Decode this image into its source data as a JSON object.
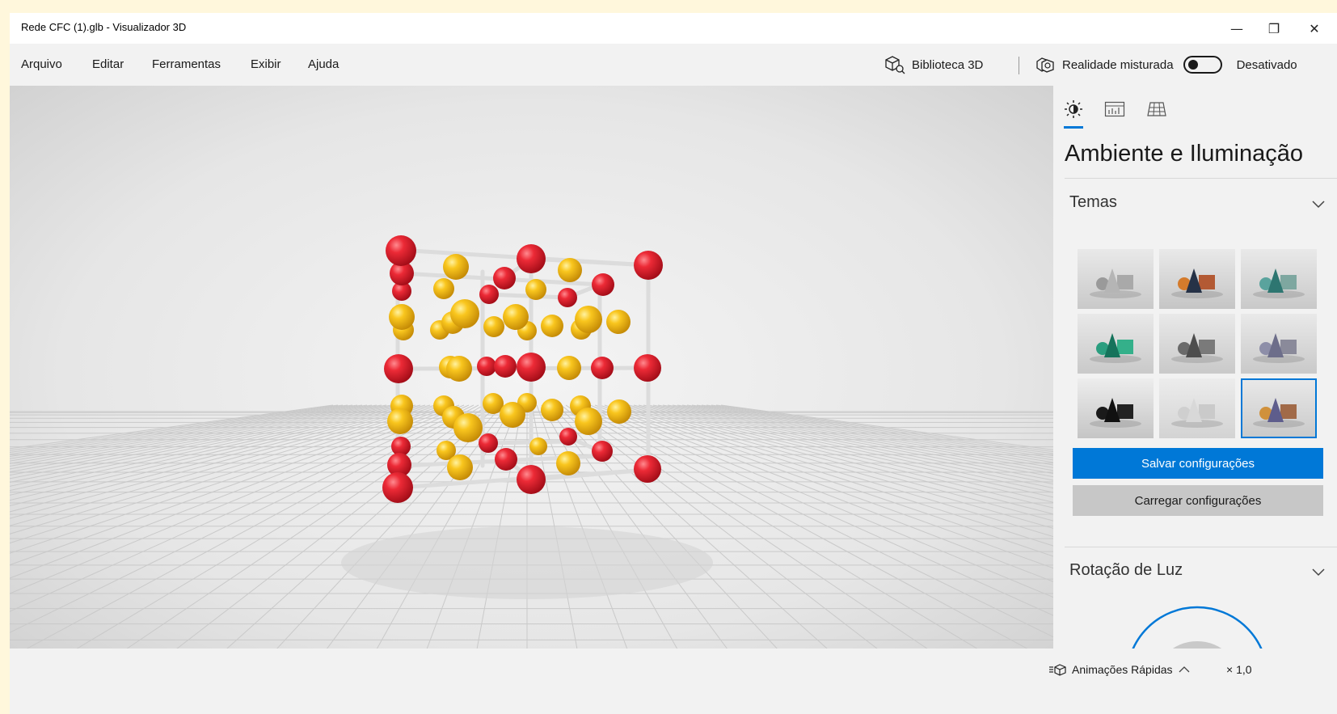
{
  "window": {
    "title": "Rede CFC (1).glb - Visualizador 3D",
    "controls": {
      "minimize": "—",
      "maximize": "❐",
      "close": "✕"
    }
  },
  "menu": {
    "items": [
      "Arquivo",
      "Editar",
      "Ferramentas",
      "Exibir",
      "Ajuda"
    ],
    "library_label": "Biblioteca 3D",
    "mixed_reality_label": "Realidade misturada",
    "mixed_reality_status": "Desativado"
  },
  "panel": {
    "tabs": [
      "sun-icon",
      "chart-icon",
      "grid-icon"
    ],
    "title": "Ambiente e Iluminação",
    "themes_label": "Temas",
    "save_button": "Salvar configurações",
    "load_button": "Carregar configurações",
    "light_rotation_label": "Rotação de Luz",
    "selected_theme": 8
  },
  "status": {
    "animations_label": "Animações Rápidas",
    "speed": "× 1,0"
  },
  "colors": {
    "accent": "#0078d7",
    "atom_red": "#e21c2b",
    "atom_yellow": "#f7c21a"
  }
}
